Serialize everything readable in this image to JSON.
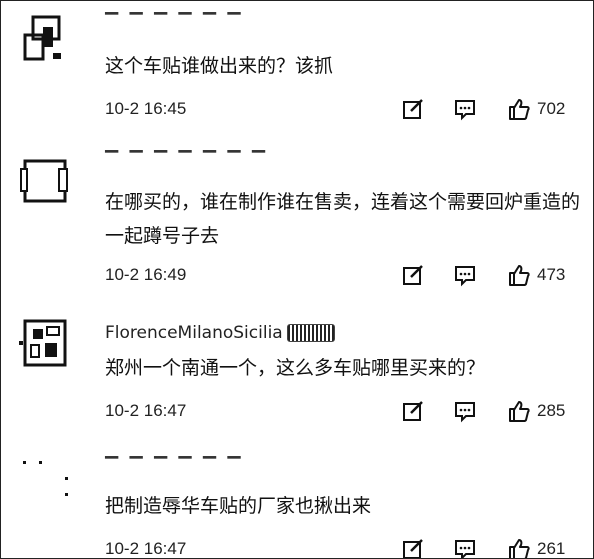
{
  "comments": [
    {
      "username": "▔ ▔ ▔ ▔ ▔ ▔",
      "text": "这个车贴谁做出来的？该抓",
      "time": "10-2 16:45",
      "likes": "702"
    },
    {
      "username": "▔ ▔ ▔ ▔ ▔ ▔ ▔",
      "text": "在哪买的，谁在制作谁在售卖，连着这个需要回炉重造的一起蹲号子去",
      "time": "10-2 16:49",
      "likes": "473"
    },
    {
      "username": "FlorenceMilanoSicilia",
      "text": "郑州一个南通一个，这么多车贴哪里买来的？",
      "time": "10-2 16:47",
      "likes": "285"
    },
    {
      "username": "▔ ▔ ▔ ▔ ▔ ▔",
      "text": "把制造辱华车贴的厂家也揪出来",
      "time": "10-2 16:47",
      "likes": "261"
    }
  ],
  "icons": {
    "edit": "edit-square-icon",
    "reply": "comment-bubble-icon",
    "like": "thumbs-up-icon"
  }
}
